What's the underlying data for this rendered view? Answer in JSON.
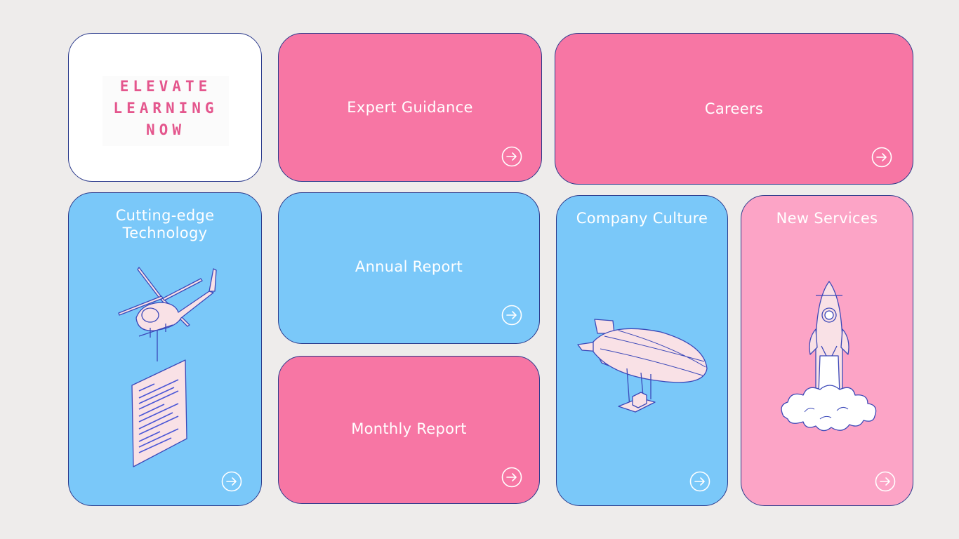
{
  "brand": {
    "line1": "ELEVATE",
    "line2": "LEARNING",
    "line3": "NOW"
  },
  "tiles": {
    "expert_guidance": {
      "label": "Expert Guidance"
    },
    "careers": {
      "label": "Careers"
    },
    "cutting_edge": {
      "line1": "Cutting-edge",
      "line2": "Technology"
    },
    "annual_report": {
      "label": "Annual Report"
    },
    "company_culture": {
      "label": "Company Culture"
    },
    "new_services": {
      "label": "New Services"
    },
    "monthly_report": {
      "label": "Monthly Report"
    }
  },
  "colors": {
    "pink": "#f776a4",
    "pink_light": "#fca4c6",
    "blue": "#7ac8f9",
    "outline": "#2b3a8c",
    "brand_text": "#e4568d",
    "background": "#eeeceb"
  },
  "icons": {
    "arrow": "arrow-right-circle-icon",
    "helicopter": "helicopter-illustration",
    "airship": "airship-illustration",
    "rocket": "rocket-illustration"
  }
}
